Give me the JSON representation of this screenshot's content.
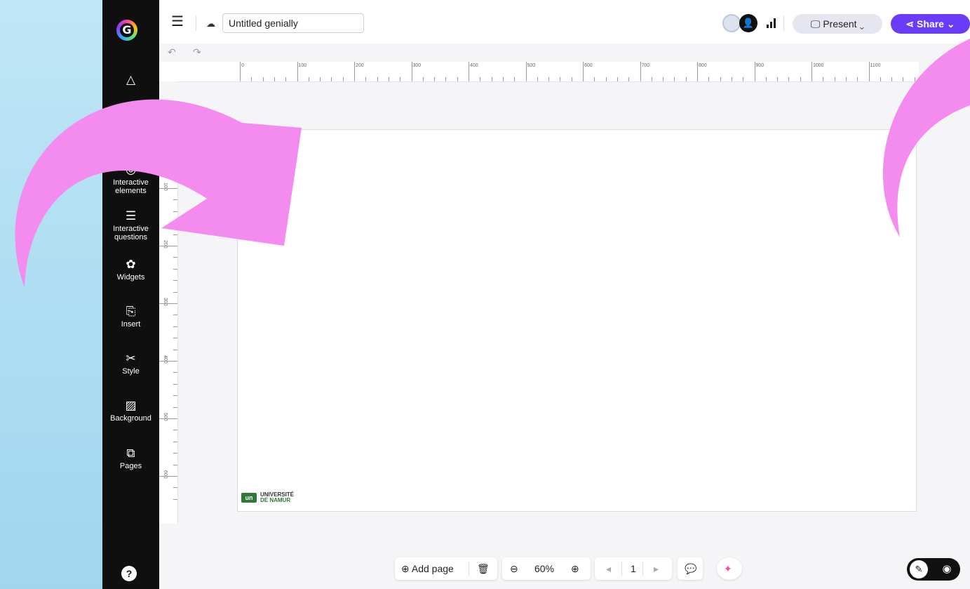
{
  "app": {
    "logo_letter": "G"
  },
  "header": {
    "title_value": "Untitled genially",
    "present_label": "Present",
    "share_label": "Share"
  },
  "sidebar": {
    "items": [
      {
        "label": "Interactive elements",
        "icon": "interactive-elements-icon"
      },
      {
        "label": "Interactive questions",
        "icon": "questions-icon"
      },
      {
        "label": "Widgets",
        "icon": "widgets-icon"
      },
      {
        "label": "Insert",
        "icon": "insert-icon"
      },
      {
        "label": "Style",
        "icon": "style-icon"
      },
      {
        "label": "Background",
        "icon": "background-icon"
      },
      {
        "label": "Pages",
        "icon": "pages-icon"
      }
    ],
    "help_label": "?"
  },
  "ruler": {
    "top_labels": [
      "0",
      "100",
      "200",
      "300",
      "400",
      "500",
      "600",
      "700",
      "800",
      "900",
      "1000",
      "1100"
    ],
    "left_labels": [
      "100",
      "200",
      "300",
      "400",
      "500",
      "600"
    ]
  },
  "canvas": {
    "logo": {
      "mark": "un",
      "line1": "UNIVERSITÉ",
      "line2": "DE NAMUR"
    }
  },
  "footer": {
    "add_page_label": "Add page",
    "zoom_value": "60%",
    "page_number": "1"
  },
  "colors": {
    "share": "#6a3cf7",
    "sidebar": "#0f0f0f",
    "arrow": "#f48cf0",
    "logo_green": "#2d7a37"
  }
}
